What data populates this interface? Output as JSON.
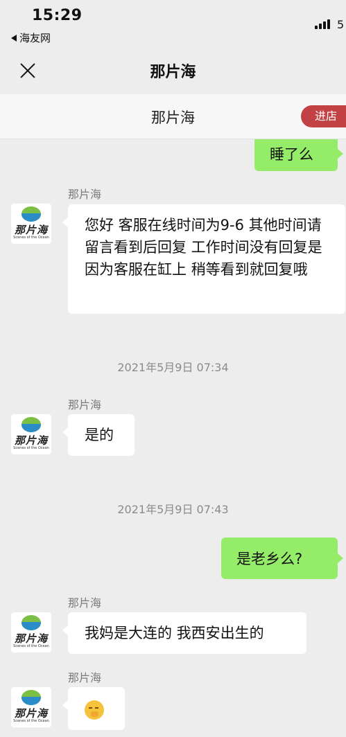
{
  "status": {
    "time": "15:29",
    "back_app": "海友网",
    "battery_partial": "5"
  },
  "nav": {
    "title": "那片海"
  },
  "shop": {
    "name": "那片海",
    "enter_label": "进店"
  },
  "messages": {
    "m1_text": "睡了么",
    "m2_sender": "那片海",
    "m2_text": "您好 客服在线时间为9-6 其他时间请留言看到后回复 工作时间没有回复是因为客服在缸上 稍等看到就回复哦",
    "ts1": "2021年5月9日 07:34",
    "m3_sender": "那片海",
    "m3_text": "是的",
    "ts2": "2021年5月9日 07:43",
    "m4_text": "是老乡么?",
    "m5_sender": "那片海",
    "m5_text": "我妈是大连的 我西安出生的",
    "m6_sender": "那片海"
  },
  "avatar": {
    "logo_text": "那片海",
    "tagline": "Scenes of the Ocean"
  }
}
